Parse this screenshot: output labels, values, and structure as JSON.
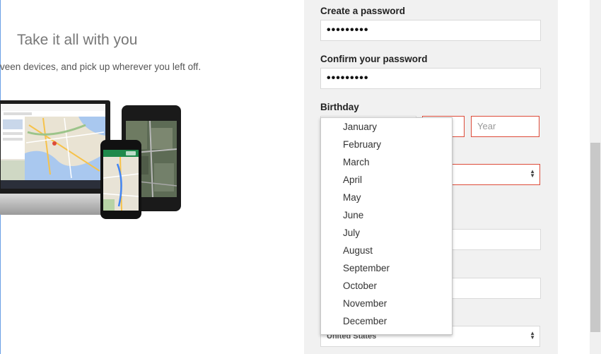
{
  "left": {
    "title": "Take it all with you",
    "subtitle": "veen devices, and pick up wherever you left off."
  },
  "form": {
    "password_label": "Create a password",
    "password_value": "•••••••••",
    "confirm_label": "Confirm your password",
    "confirm_value": "•••••••••",
    "birthday_label": "Birthday",
    "year_placeholder": "Year",
    "country_value": "United States"
  },
  "month_options": [
    "January",
    "February",
    "March",
    "April",
    "May",
    "June",
    "July",
    "August",
    "September",
    "October",
    "November",
    "December"
  ],
  "colors": {
    "error": "#dd4b39",
    "panel": "#f1f1f1"
  },
  "icons": [
    "updown-caret-icon"
  ]
}
